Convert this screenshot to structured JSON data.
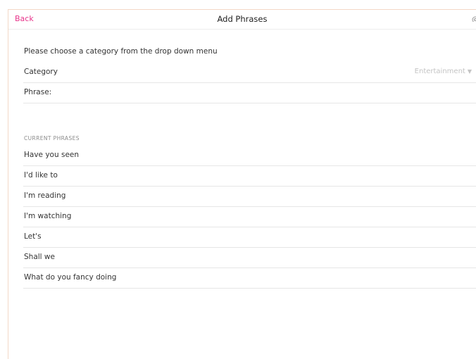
{
  "navbar": {
    "back_label": "Back",
    "title": "Add Phrases",
    "settings_icon": "gear-icon"
  },
  "form": {
    "instruction": "Please choose a category from the drop down menu",
    "category_label": "Category",
    "category_value": "Entertainment",
    "phrase_label": "Phrase:"
  },
  "current_phrases": {
    "header": "CURRENT PHRASES",
    "items": [
      "Have you seen",
      "I'd like to",
      "I'm reading",
      "I'm watching",
      "Let's",
      "Shall we",
      "What do you fancy doing"
    ]
  },
  "colors": {
    "accent": "#e8338a",
    "frame_border": "#f3d8c6",
    "separator": "#e6e6e6",
    "placeholder": "#c4c4c4"
  }
}
